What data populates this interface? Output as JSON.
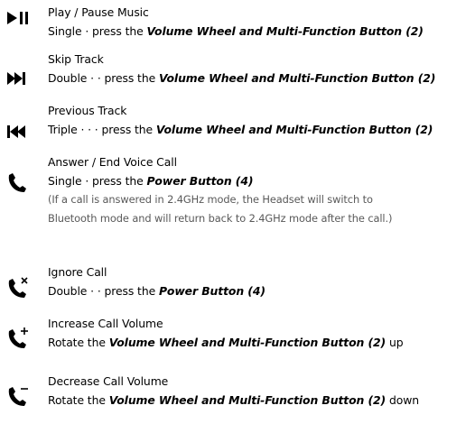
{
  "items": [
    {
      "icon": "play-pause-icon",
      "title": "Play / Pause Music",
      "action_prefix": "Single · press the ",
      "action_button": "Volume Wheel and Multi-Function Button (2)",
      "action_suffix": ""
    },
    {
      "icon": "skip-forward-icon",
      "title": "Skip Track",
      "action_prefix": "Double · · press the ",
      "action_button": "Volume Wheel and Multi-Function Button (2)",
      "action_suffix": ""
    },
    {
      "icon": "skip-back-icon",
      "title": "Previous Track",
      "action_prefix": "Triple · · · press the ",
      "action_button": "Volume Wheel and Multi-Function Button (2)",
      "action_suffix": ""
    },
    {
      "icon": "phone-icon",
      "title": "Answer / End Voice Call",
      "action_prefix": "Single · press the ",
      "action_button": "Power Button (4)",
      "action_suffix": "",
      "note_line1": "(If a call is answered in 2.4GHz mode, the Headset will switch to",
      "note_line2": "Bluetooth mode and will return back to 2.4GHz mode after the call.)"
    },
    {
      "icon": "phone-ignore-icon",
      "title": "Ignore Call",
      "action_prefix": "Double · · press the ",
      "action_button": "Power Button (4)",
      "action_suffix": ""
    },
    {
      "icon": "phone-volume-up-icon",
      "title": "Increase Call Volume",
      "action_prefix": "Rotate the ",
      "action_button": "Volume Wheel and Multi-Function Button (2)",
      "action_suffix": " up"
    },
    {
      "icon": "phone-volume-down-icon",
      "title": "Decrease Call Volume",
      "action_prefix": "Rotate the ",
      "action_button": "Volume Wheel and Multi-Function Button (2)",
      "action_suffix": " down"
    }
  ]
}
